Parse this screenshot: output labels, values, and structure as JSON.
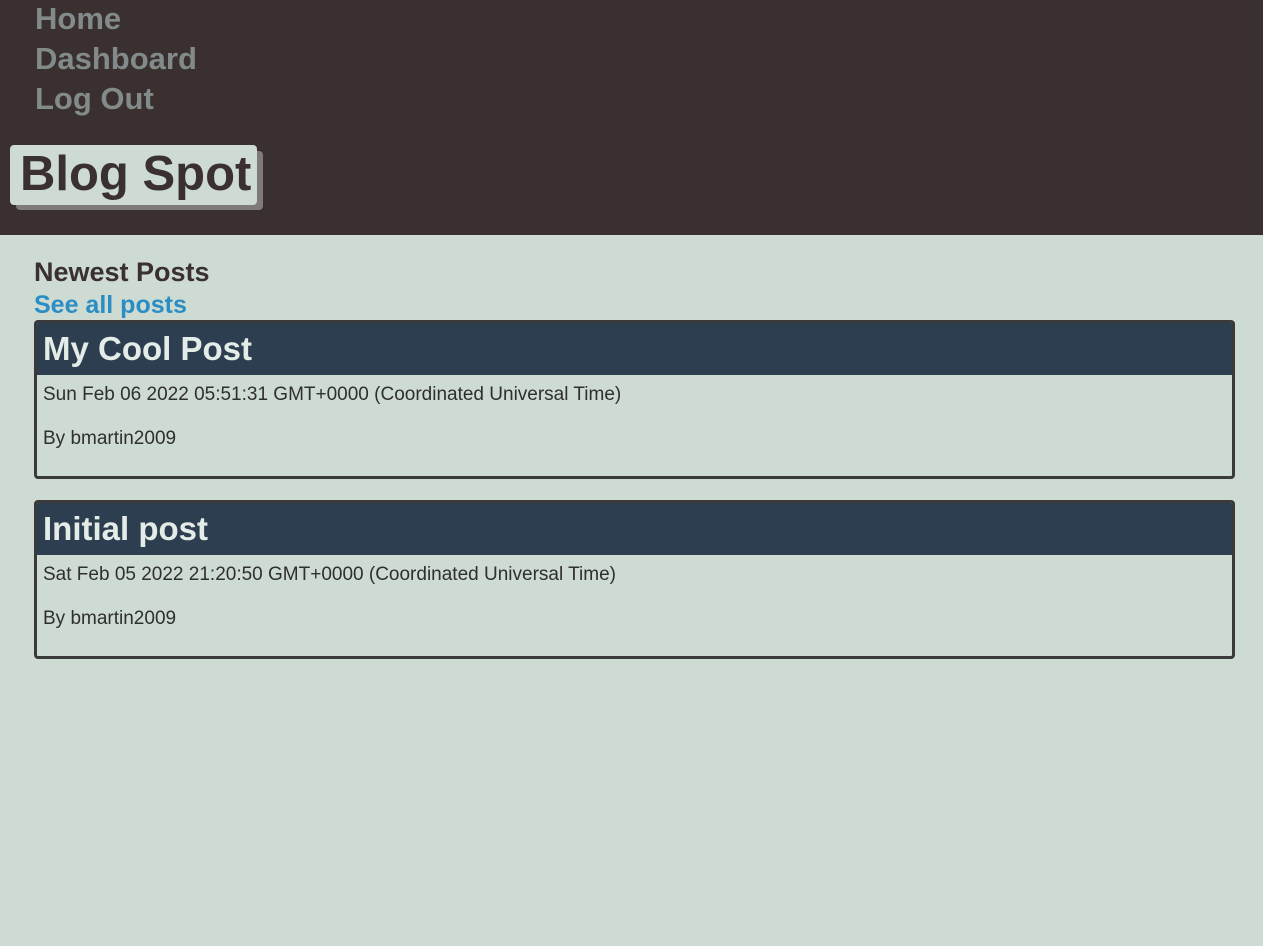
{
  "nav": {
    "items": [
      {
        "label": "Home"
      },
      {
        "label": "Dashboard"
      },
      {
        "label": "Log Out"
      }
    ]
  },
  "site": {
    "title": "Blog Spot"
  },
  "main": {
    "heading": "Newest Posts",
    "see_all_label": "See all posts",
    "posts": [
      {
        "title": "My Cool Post",
        "date": "Sun Feb 06 2022 05:51:31 GMT+0000 (Coordinated Universal Time)",
        "author": "By bmartin2009"
      },
      {
        "title": "Initial post",
        "date": "Sat Feb 05 2022 21:20:50 GMT+0000 (Coordinated Universal Time)",
        "author": "By bmartin2009"
      }
    ]
  },
  "colors": {
    "header_bg": "#3a3030",
    "page_bg": "#cddbd3",
    "nav_text": "#828b8a",
    "link": "#2a8ec4",
    "post_header_bg": "#2d3e50"
  }
}
